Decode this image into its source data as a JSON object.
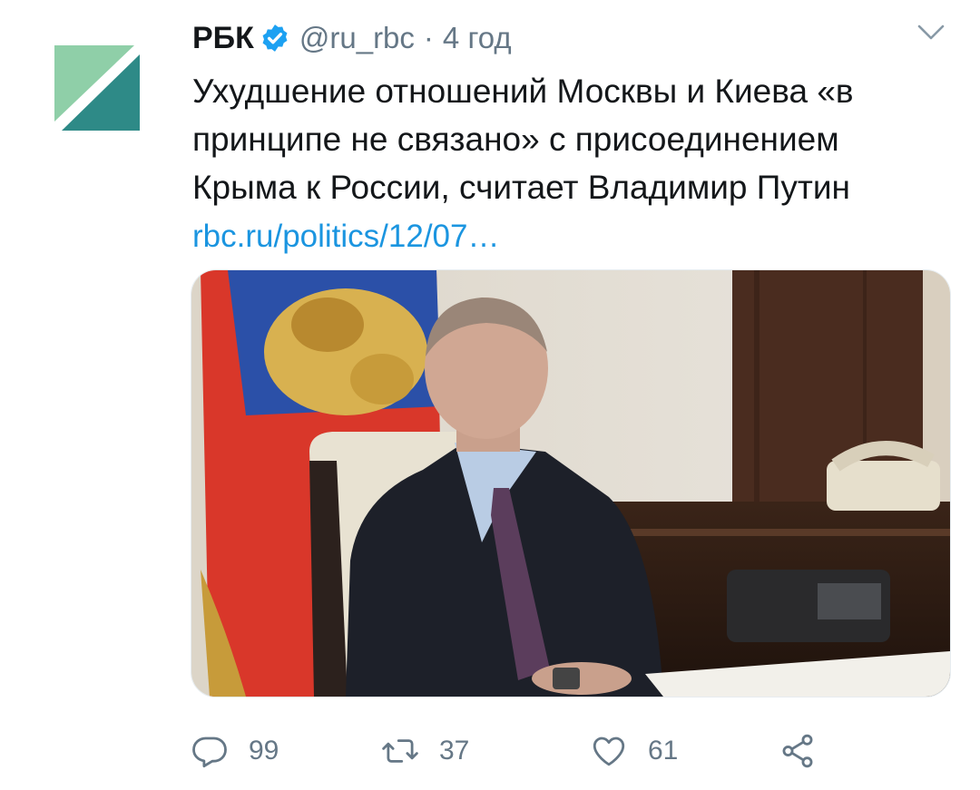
{
  "tweet": {
    "author_name": "РБК",
    "handle": "@ru_rbc",
    "separator": "·",
    "time": "4 год",
    "text_lines": [
      "Ухудшение отношений Москвы и Киева «в",
      "принципе не связано» с присоединением",
      "Крыма к России, считает Владимир Путин"
    ],
    "link": "rbc.ru/politics/12/07…"
  },
  "actions": {
    "reply_count": "99",
    "retweet_count": "37",
    "like_count": "61"
  },
  "icons": {
    "avatar": "rbc-logo-icon",
    "verified": "verified-badge-icon",
    "menu": "chevron-down-icon",
    "reply": "reply-icon",
    "retweet": "retweet-icon",
    "like": "heart-icon",
    "share": "share-icon"
  },
  "colors": {
    "link": "#1b95e0",
    "secondary_text": "#657786",
    "verified": "#1da1f2",
    "logo_green": "#8fcfa8",
    "logo_teal": "#2e8a87"
  }
}
